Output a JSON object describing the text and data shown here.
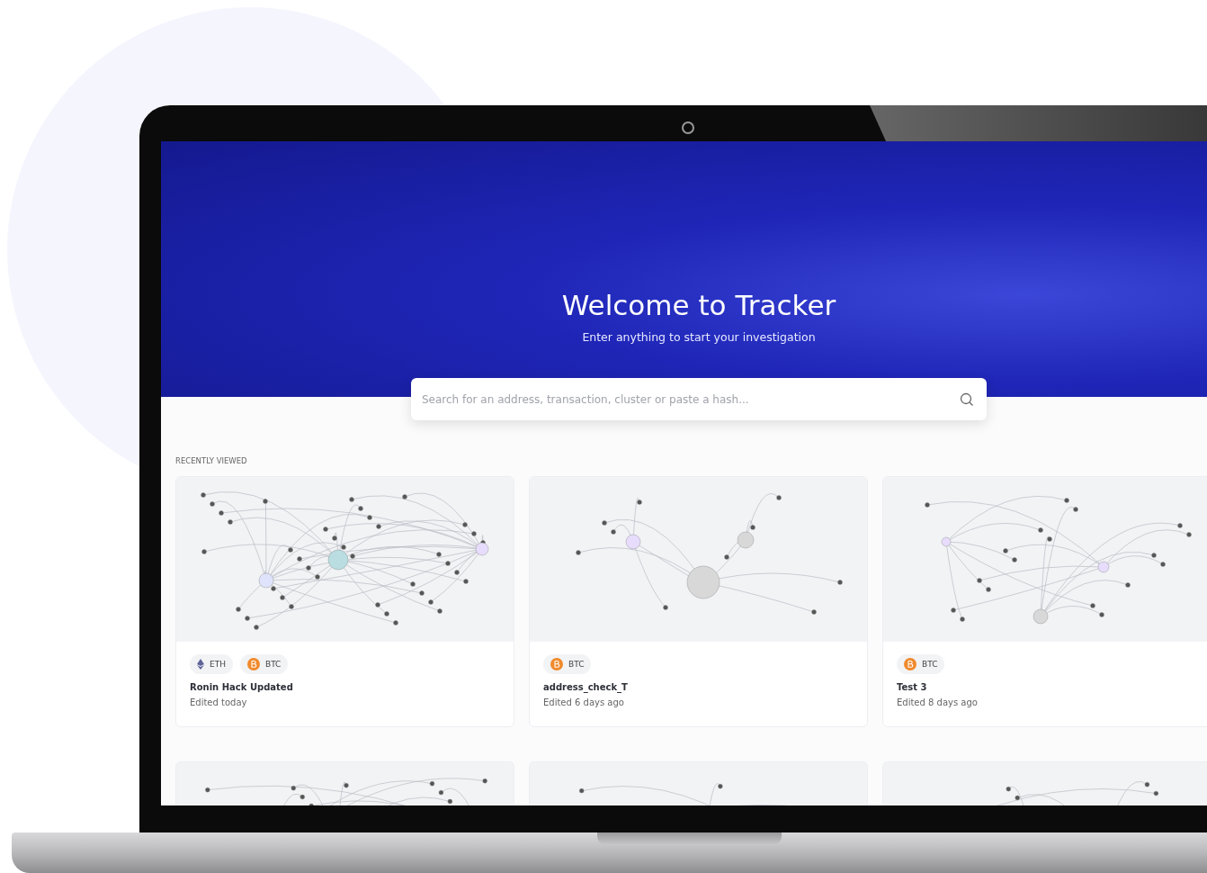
{
  "hero": {
    "title": "Welcome to Tracker",
    "subtitle": "Enter anything to start your investigation"
  },
  "search": {
    "placeholder": "Search for an address, transaction, cluster or paste a hash..."
  },
  "section_label": "RECENTLY VIEWED",
  "cards": [
    {
      "kind": "full",
      "chains": [
        {
          "kind": "eth",
          "label": "ETH"
        },
        {
          "kind": "btc",
          "label": "BTC"
        }
      ],
      "title": "Ronin Hack Updated",
      "edited": "Edited today"
    },
    {
      "kind": "full",
      "chains": [
        {
          "kind": "btc",
          "label": "BTC"
        }
      ],
      "title": "address_check_T",
      "edited": "Edited 6 days ago"
    },
    {
      "kind": "full",
      "chains": [
        {
          "kind": "btc",
          "label": "BTC"
        }
      ],
      "title": "Test 3",
      "edited": "Edited 8 days ago"
    },
    {
      "kind": "cut"
    },
    {
      "kind": "cut"
    },
    {
      "kind": "cut"
    }
  ]
}
